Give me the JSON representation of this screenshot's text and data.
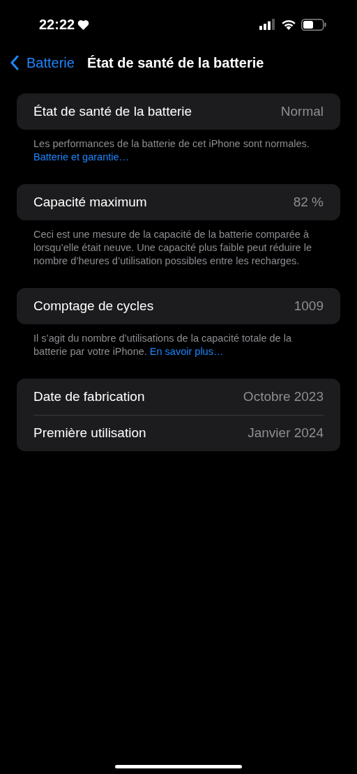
{
  "status_bar": {
    "time": "22:22"
  },
  "nav": {
    "back": "Batterie",
    "title": "État de santé de la batterie"
  },
  "sections": [
    {
      "rows": [
        {
          "label": "État de santé de la batterie",
          "value": "Normal"
        }
      ],
      "footer": "Les performances de la batterie de cet iPhone sont normales.",
      "link": "Batterie et garantie…"
    },
    {
      "rows": [
        {
          "label": "Capacité maximum",
          "value": "82 %"
        }
      ],
      "footer": "Ceci est une mesure de la capacité de la batterie comparée à lorsqu’elle était neuve. Une capacité plus faible peut réduire le nombre d’heures d’utilisation possibles entre les recharges."
    },
    {
      "rows": [
        {
          "label": "Comptage de cycles",
          "value": "1009"
        }
      ],
      "footer": "Il s’agit du nombre d’utilisations de la capacité totale de la batterie par votre iPhone.",
      "link": "En savoir plus…"
    },
    {
      "rows": [
        {
          "label": "Date de fabrication",
          "value": "Octobre 2023"
        },
        {
          "label": "Première utilisation",
          "value": "Janvier 2024"
        }
      ]
    }
  ]
}
